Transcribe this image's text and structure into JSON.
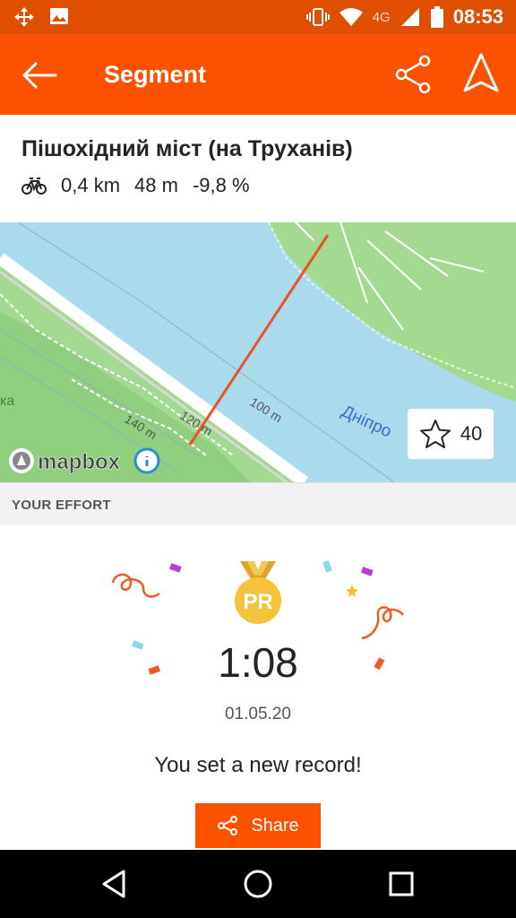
{
  "status_bar": {
    "time": "08:53",
    "network": "4G",
    "icons": [
      "move-icon",
      "image-icon",
      "vibrate-icon",
      "wifi-icon",
      "signal-icon",
      "battery-icon"
    ]
  },
  "app_bar": {
    "title": "Segment",
    "color": "#fc5200"
  },
  "segment": {
    "name": "Пішохідний міст (на Труханів)",
    "activity_icon": "bike-icon",
    "distance": "0,4 km",
    "elevation": "48 m",
    "grade": "-9,8 %"
  },
  "map": {
    "river_label": "Дніпро",
    "contour_labels": [
      "100 m",
      "120 m",
      "140 m"
    ],
    "edge_label": "ка",
    "attribution": "mapbox",
    "star_count": "40"
  },
  "effort": {
    "section_label": "YOUR EFFORT",
    "badge": "PR",
    "time": "1:08",
    "date": "01.05.20",
    "message": "You set a new record!",
    "share_label": "Share"
  }
}
